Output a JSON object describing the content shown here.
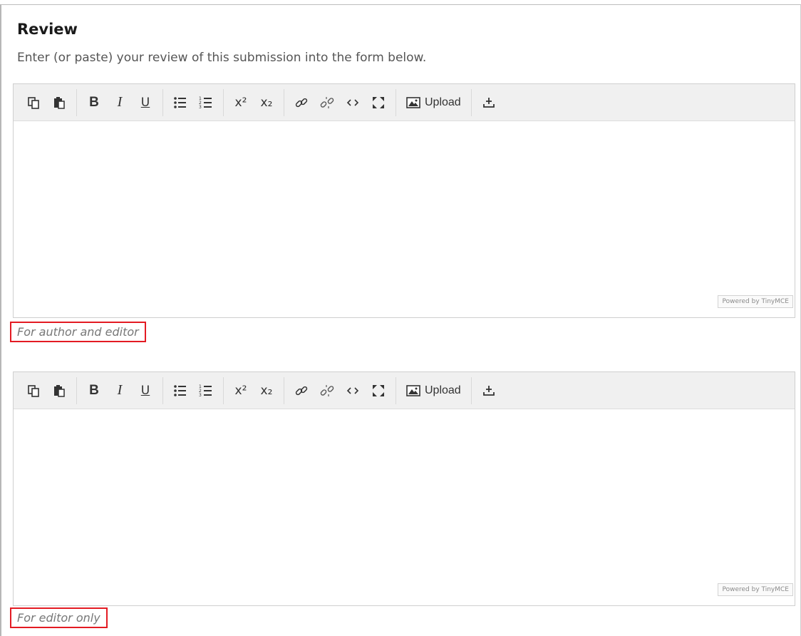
{
  "section": {
    "title": "Review",
    "description": "Enter (or paste) your review of this submission into the form below."
  },
  "toolbar": {
    "upload_label": "Upload",
    "superscript_mark": "x²",
    "subscript_mark": "x₂",
    "bold_label": "B",
    "italic_label": "I",
    "underline_label": "U",
    "icons": [
      "copy-icon",
      "paste-icon",
      "bold-icon",
      "italic-icon",
      "underline-icon",
      "bullet-list-icon",
      "numbered-list-icon",
      "superscript-icon",
      "subscript-icon",
      "link-icon",
      "unlink-icon",
      "code-icon",
      "fullscreen-icon",
      "image-upload-icon",
      "download-icon"
    ]
  },
  "editors": [
    {
      "powered_by": "Powered by TinyMCE",
      "note": "For author and editor"
    },
    {
      "powered_by": "Powered by TinyMCE",
      "note": "For editor only"
    }
  ],
  "colors": {
    "highlight_border": "#e31b23",
    "toolbar_bg": "#f0f0f0"
  }
}
